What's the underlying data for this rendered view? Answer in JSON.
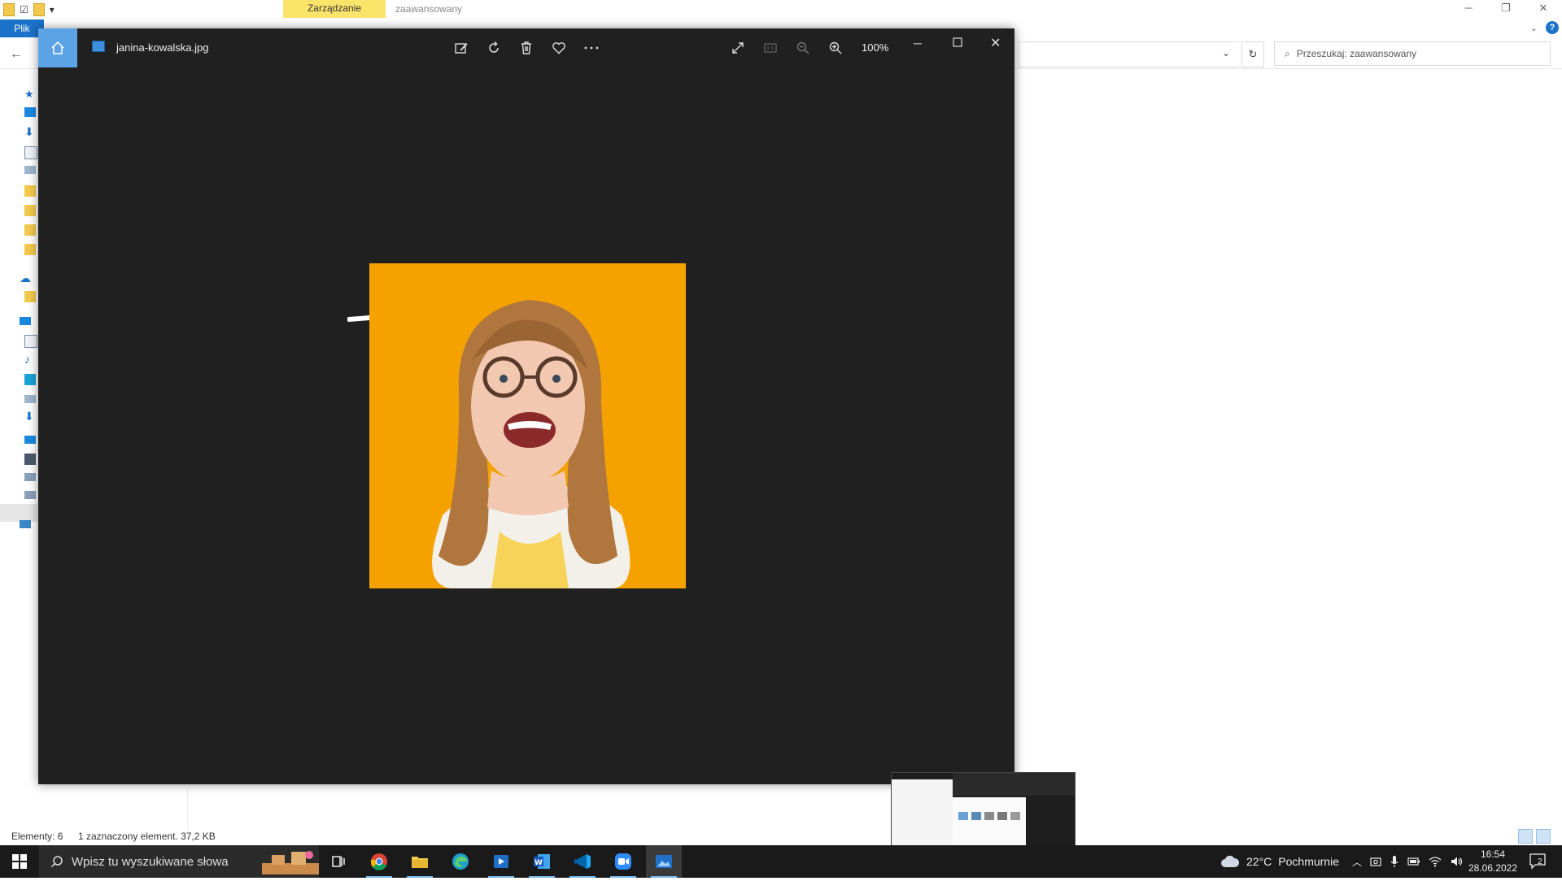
{
  "explorer": {
    "context_tab": "Zarządzanie",
    "context_title": "zaawansowany",
    "file_tab": "Plik",
    "search_placeholder": "Przeszukaj: zaawansowany",
    "status_count": "Elementy: 6",
    "status_selection": "1 zaznaczony element. 37,2 KB"
  },
  "photos": {
    "file_name": "janina-kowalska.jpg",
    "zoom": "100%",
    "toolbar_icons": [
      "edit-image-icon",
      "rotate-icon",
      "delete-icon",
      "favorite-icon",
      "more-icon"
    ],
    "view_icons": [
      "fullscreen-icon",
      "actual-size-icon",
      "zoom-out-icon",
      "zoom-in-icon"
    ],
    "photo_background": "#f5a200"
  },
  "taskbar": {
    "search_placeholder": "Wpisz tu wyszukiwane słowa",
    "apps": [
      "task-view",
      "chrome",
      "file-explorer",
      "edge",
      "media-player",
      "word",
      "vscode",
      "zoom",
      "photos"
    ],
    "temperature": "22°C",
    "weather": "Pochmurnie",
    "time": "16:54",
    "date": "28.06.2022",
    "notifications": "2"
  }
}
